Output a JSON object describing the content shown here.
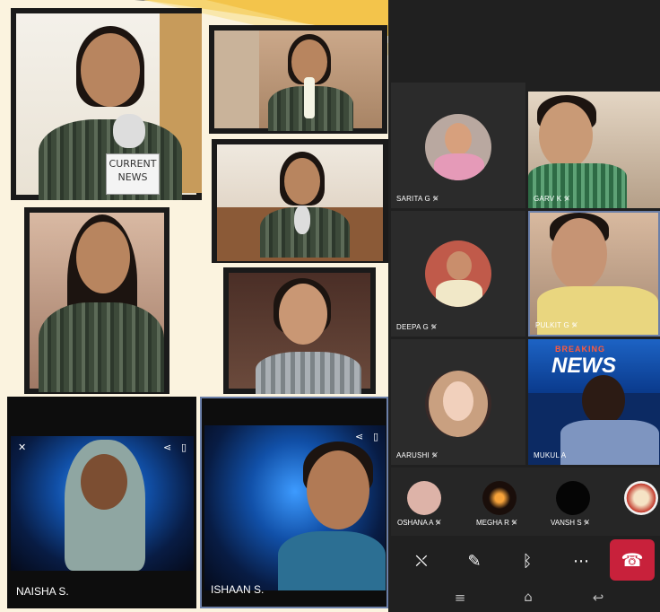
{
  "grid_tiles": [
    {
      "name": "SARITA G",
      "mic_icon": "mic-off-icon"
    },
    {
      "name": "GARV K",
      "mic_icon": "mic-off-icon"
    },
    {
      "name": "DEEPA G",
      "mic_icon": "mic-off-icon"
    },
    {
      "name": "PULKIT G",
      "mic_icon": "mic-off-icon"
    },
    {
      "name": "AARUSHI",
      "mic_icon": "mic-off-icon"
    },
    {
      "name": "MUKUL A",
      "mic_icon": "mic-off-icon"
    }
  ],
  "strip": [
    {
      "name": "OSHANA A"
    },
    {
      "name": "MEGHA R"
    },
    {
      "name": "VANSH S"
    },
    {
      "name": ""
    }
  ],
  "mute_mark": "✎̸",
  "news_sign": {
    "line1": "CURRENT",
    "line2": "NEWS"
  },
  "breaking_news": {
    "top": "BREAKING",
    "main": "NEWS"
  },
  "student_labels": {
    "naisha": "NAISHA S.",
    "ishaan": "ISHAAN S."
  },
  "controls": {
    "video": "video-off-icon",
    "mic": "mic-off-icon",
    "bluetooth": "bluetooth-icon",
    "more": "more-icon",
    "end": "end-call-icon"
  },
  "colors": {
    "end_call": "#c8213b",
    "banner_yellow": "#f3c44b",
    "banner_teal": "#17928c",
    "background": "#fbf3df"
  }
}
